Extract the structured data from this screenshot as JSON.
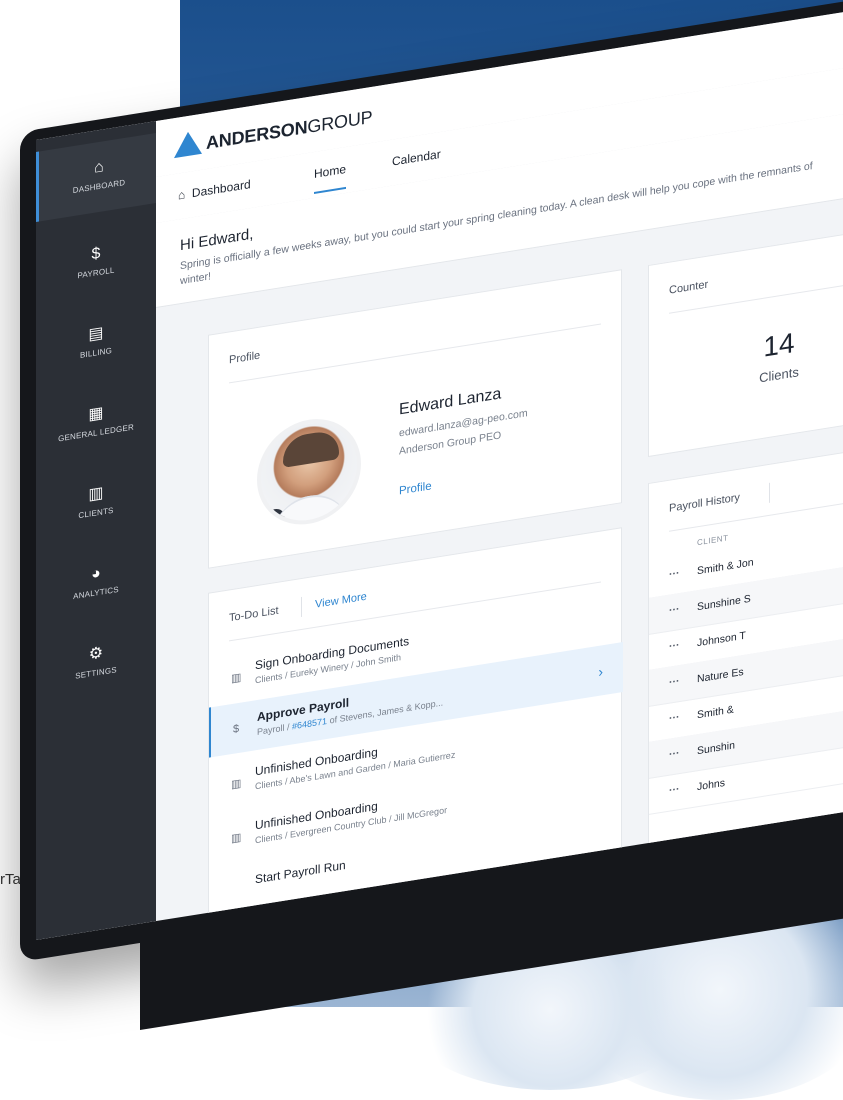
{
  "outside_text": "rTax",
  "brand": {
    "name_bold": "ANDERSON",
    "name_rest": "GROUP",
    "accent": "#2f86d0"
  },
  "sidebar": {
    "items": [
      {
        "label": "Dashboard",
        "icon": "home-icon",
        "glyph": "⌂"
      },
      {
        "label": "Payroll",
        "icon": "dollar-icon",
        "glyph": "$"
      },
      {
        "label": "Billing",
        "icon": "invoice-icon",
        "glyph": "▤"
      },
      {
        "label": "General Ledger",
        "icon": "ledger-icon",
        "glyph": "▦"
      },
      {
        "label": "Clients",
        "icon": "building-icon",
        "glyph": "▥"
      },
      {
        "label": "Analytics",
        "icon": "pie-chart-icon",
        "glyph": "◕"
      },
      {
        "label": "Settings",
        "icon": "gear-icon",
        "glyph": "⚙"
      }
    ]
  },
  "tabs": {
    "breadcrumb": "Dashboard",
    "home": "Home",
    "calendar": "Calendar"
  },
  "greeting": {
    "title": "Hi Edward,",
    "message": "Spring is officially a few weeks away, but you could start your spring cleaning today. A clean desk will help you cope with the remnants of winter!"
  },
  "profile": {
    "card_title": "Profile",
    "name": "Edward Lanza",
    "email": "edward.lanza@ag-peo.com",
    "company": "Anderson Group PEO",
    "link": "Profile"
  },
  "counter": {
    "card_title": "Counter",
    "value": "14",
    "label": "Clients"
  },
  "todo": {
    "title": "To-Do List",
    "view_more": "View More",
    "items": [
      {
        "title": "Sign Onboarding Documents",
        "sub": "Clients / Eureky Winery / John Smith",
        "sub_link": "",
        "sub_rest": ""
      },
      {
        "title": "Approve Payroll",
        "sub": "Payroll / ",
        "sub_link": "#648571",
        "sub_rest": " of Stevens, James & Kopp..."
      },
      {
        "title": "Unfinished Onboarding",
        "sub": "Clients / Abe's Lawn and Garden / Maria Gutierrez",
        "sub_link": "",
        "sub_rest": ""
      },
      {
        "title": "Unfinished Onboarding",
        "sub": "Clients / Evergreen Country Club / Jill McGregor",
        "sub_link": "",
        "sub_rest": ""
      },
      {
        "title": "Start Payroll Run",
        "sub": "",
        "sub_link": "",
        "sub_rest": ""
      }
    ]
  },
  "payroll_history": {
    "title": "Payroll History",
    "column": "CLIENT",
    "rows": [
      "Smith & Jon",
      "Sunshine S",
      "Johnson T",
      "Nature Es",
      "Smith &",
      "Sunshin",
      "Johns"
    ]
  }
}
